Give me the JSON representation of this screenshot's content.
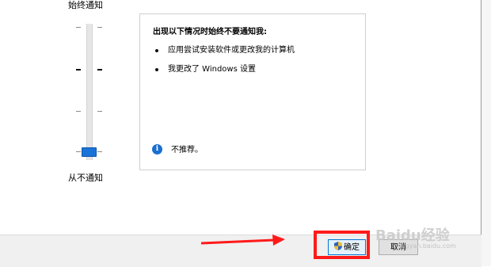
{
  "slider": {
    "top_label": "始终通知",
    "bottom_label": "从不通知"
  },
  "info": {
    "heading": "出现以下情况时始终不要通知我:",
    "items": [
      "应用尝试安装软件或更改我的计算机",
      "我更改了 Windows 设置"
    ],
    "note": "不推荐。",
    "info_icon_glyph": "i"
  },
  "buttons": {
    "ok": "确定",
    "cancel": "取消"
  },
  "watermark": {
    "brand": "Baidu经验",
    "sub": "jingyan.baidu.com"
  },
  "colors": {
    "accent": "#1a73d8",
    "highlight": "#ff1a1a"
  }
}
